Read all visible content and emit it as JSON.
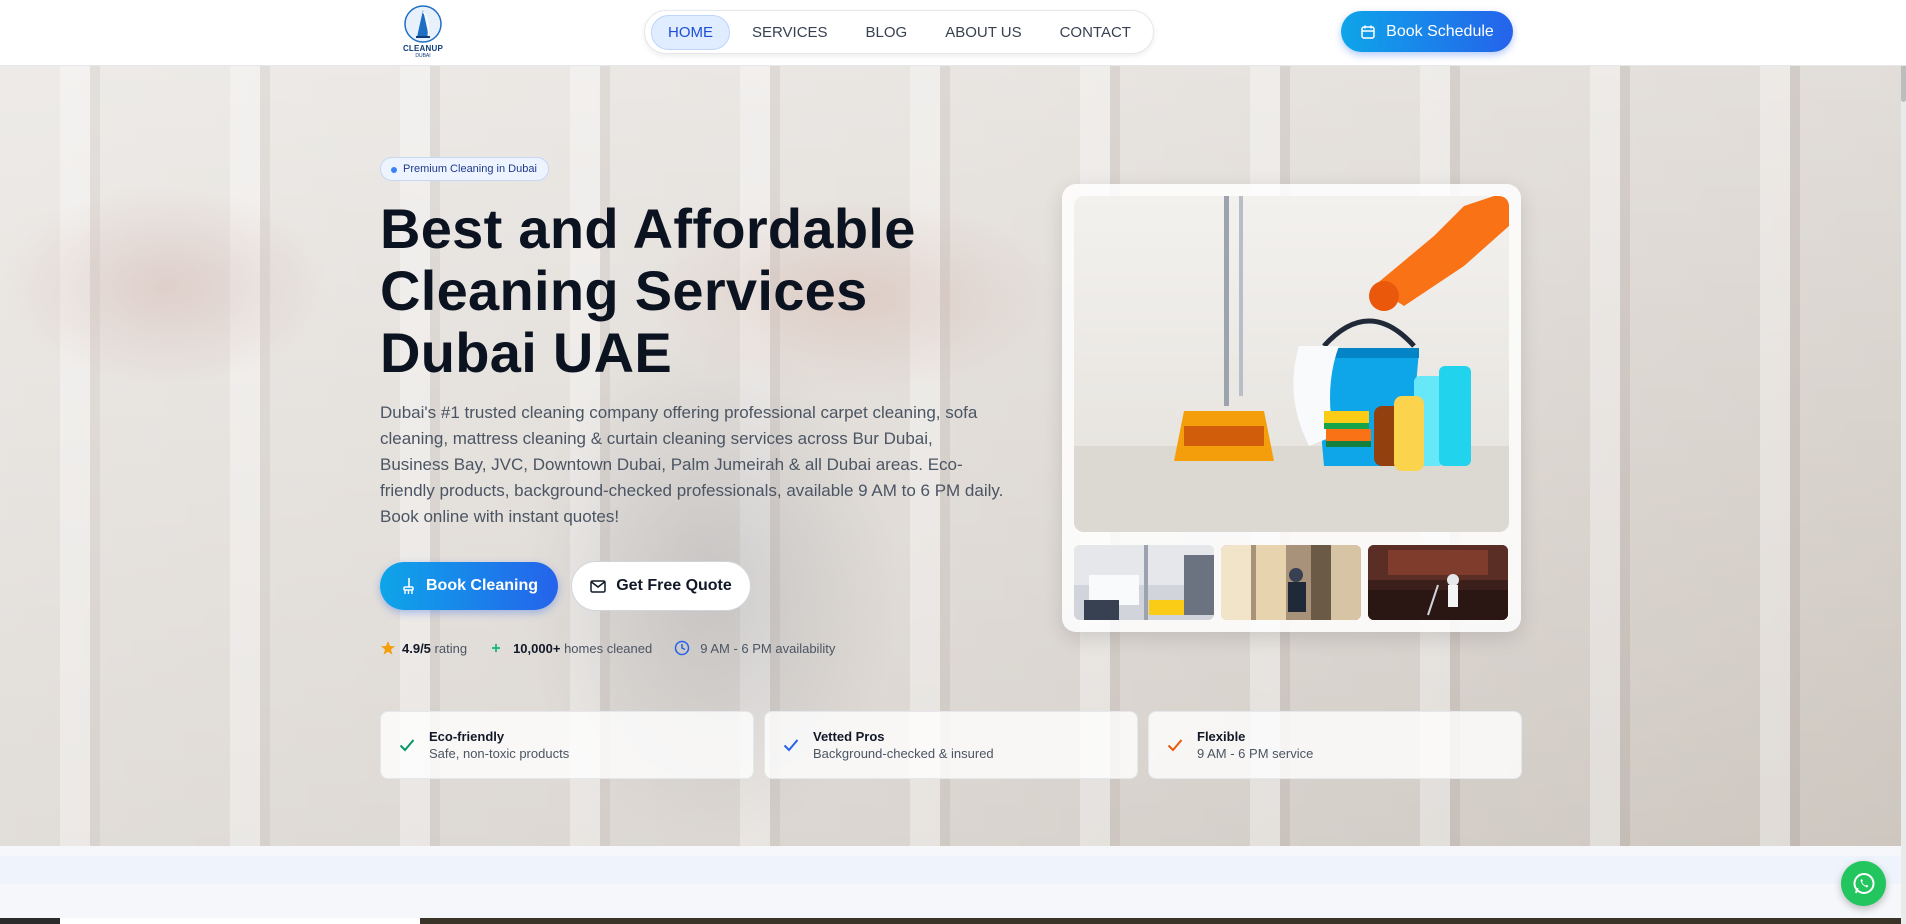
{
  "logo": {
    "name": "CLEANUP",
    "sub": "DUBAI"
  },
  "nav": {
    "items": [
      {
        "label": "HOME",
        "active": true
      },
      {
        "label": "SERVICES",
        "active": false
      },
      {
        "label": "BLOG",
        "active": false
      },
      {
        "label": "ABOUT US",
        "active": false
      },
      {
        "label": "CONTACT",
        "active": false
      }
    ]
  },
  "header": {
    "cta_label": "Book Schedule",
    "cta_icon": "calendar-icon"
  },
  "hero": {
    "badge": "Premium Cleaning in Dubai",
    "title_lines": [
      "Best and Affordable",
      "Cleaning Services",
      "Dubai UAE"
    ],
    "description": "Dubai's #1 trusted cleaning company offering professional carpet cleaning, sofa cleaning, mattress cleaning & curtain cleaning services across Bur Dubai, Business Bay, JVC, Downtown Dubai, Palm Jumeirah & all Dubai areas. Eco-friendly products, background-checked professionals, available 9 AM to 6 PM daily. Book online with instant quotes!",
    "primary_button": "Book Cleaning",
    "secondary_button": "Get Free Quote",
    "stats": [
      {
        "icon": "star-icon",
        "value": "4.9/5",
        "label": "rating"
      },
      {
        "icon": "sparkle-icon",
        "value": "10,000+",
        "label": "homes cleaned"
      },
      {
        "icon": "clock-icon",
        "value": "",
        "label": "9 AM - 6 PM availability"
      }
    ]
  },
  "features": [
    {
      "title": "Eco-friendly",
      "subtitle": "Safe, non-toxic products",
      "check_color": "#059669"
    },
    {
      "title": "Vetted Pros",
      "subtitle": "Background-checked & insured",
      "check_color": "#2563eb"
    },
    {
      "title": "Flexible",
      "subtitle": "9 AM - 6 PM service",
      "check_color": "#ea580c"
    }
  ],
  "colors": {
    "accent_from": "#0ea5e9",
    "accent_to": "#2563eb",
    "whatsapp": "#22c55e"
  }
}
